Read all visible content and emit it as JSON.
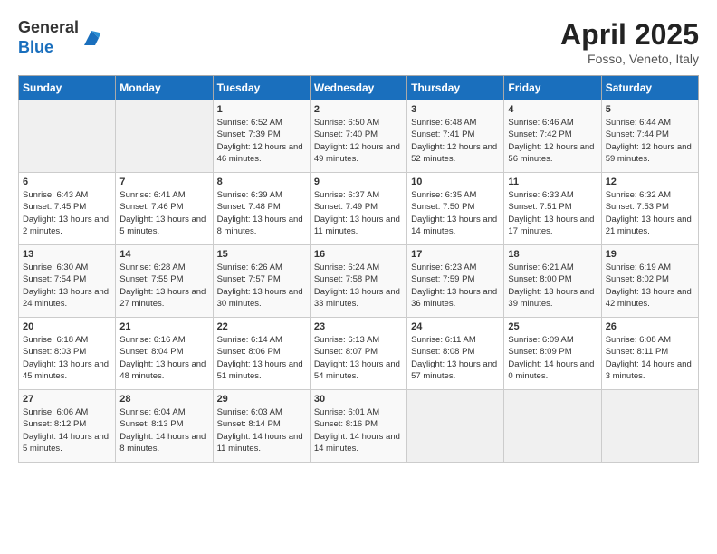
{
  "logo": {
    "general": "General",
    "blue": "Blue"
  },
  "title": "April 2025",
  "subtitle": "Fosso, Veneto, Italy",
  "weekdays": [
    "Sunday",
    "Monday",
    "Tuesday",
    "Wednesday",
    "Thursday",
    "Friday",
    "Saturday"
  ],
  "weeks": [
    [
      {
        "day": "",
        "info": ""
      },
      {
        "day": "",
        "info": ""
      },
      {
        "day": "1",
        "info": "Sunrise: 6:52 AM\nSunset: 7:39 PM\nDaylight: 12 hours and 46 minutes."
      },
      {
        "day": "2",
        "info": "Sunrise: 6:50 AM\nSunset: 7:40 PM\nDaylight: 12 hours and 49 minutes."
      },
      {
        "day": "3",
        "info": "Sunrise: 6:48 AM\nSunset: 7:41 PM\nDaylight: 12 hours and 52 minutes."
      },
      {
        "day": "4",
        "info": "Sunrise: 6:46 AM\nSunset: 7:42 PM\nDaylight: 12 hours and 56 minutes."
      },
      {
        "day": "5",
        "info": "Sunrise: 6:44 AM\nSunset: 7:44 PM\nDaylight: 12 hours and 59 minutes."
      }
    ],
    [
      {
        "day": "6",
        "info": "Sunrise: 6:43 AM\nSunset: 7:45 PM\nDaylight: 13 hours and 2 minutes."
      },
      {
        "day": "7",
        "info": "Sunrise: 6:41 AM\nSunset: 7:46 PM\nDaylight: 13 hours and 5 minutes."
      },
      {
        "day": "8",
        "info": "Sunrise: 6:39 AM\nSunset: 7:48 PM\nDaylight: 13 hours and 8 minutes."
      },
      {
        "day": "9",
        "info": "Sunrise: 6:37 AM\nSunset: 7:49 PM\nDaylight: 13 hours and 11 minutes."
      },
      {
        "day": "10",
        "info": "Sunrise: 6:35 AM\nSunset: 7:50 PM\nDaylight: 13 hours and 14 minutes."
      },
      {
        "day": "11",
        "info": "Sunrise: 6:33 AM\nSunset: 7:51 PM\nDaylight: 13 hours and 17 minutes."
      },
      {
        "day": "12",
        "info": "Sunrise: 6:32 AM\nSunset: 7:53 PM\nDaylight: 13 hours and 21 minutes."
      }
    ],
    [
      {
        "day": "13",
        "info": "Sunrise: 6:30 AM\nSunset: 7:54 PM\nDaylight: 13 hours and 24 minutes."
      },
      {
        "day": "14",
        "info": "Sunrise: 6:28 AM\nSunset: 7:55 PM\nDaylight: 13 hours and 27 minutes."
      },
      {
        "day": "15",
        "info": "Sunrise: 6:26 AM\nSunset: 7:57 PM\nDaylight: 13 hours and 30 minutes."
      },
      {
        "day": "16",
        "info": "Sunrise: 6:24 AM\nSunset: 7:58 PM\nDaylight: 13 hours and 33 minutes."
      },
      {
        "day": "17",
        "info": "Sunrise: 6:23 AM\nSunset: 7:59 PM\nDaylight: 13 hours and 36 minutes."
      },
      {
        "day": "18",
        "info": "Sunrise: 6:21 AM\nSunset: 8:00 PM\nDaylight: 13 hours and 39 minutes."
      },
      {
        "day": "19",
        "info": "Sunrise: 6:19 AM\nSunset: 8:02 PM\nDaylight: 13 hours and 42 minutes."
      }
    ],
    [
      {
        "day": "20",
        "info": "Sunrise: 6:18 AM\nSunset: 8:03 PM\nDaylight: 13 hours and 45 minutes."
      },
      {
        "day": "21",
        "info": "Sunrise: 6:16 AM\nSunset: 8:04 PM\nDaylight: 13 hours and 48 minutes."
      },
      {
        "day": "22",
        "info": "Sunrise: 6:14 AM\nSunset: 8:06 PM\nDaylight: 13 hours and 51 minutes."
      },
      {
        "day": "23",
        "info": "Sunrise: 6:13 AM\nSunset: 8:07 PM\nDaylight: 13 hours and 54 minutes."
      },
      {
        "day": "24",
        "info": "Sunrise: 6:11 AM\nSunset: 8:08 PM\nDaylight: 13 hours and 57 minutes."
      },
      {
        "day": "25",
        "info": "Sunrise: 6:09 AM\nSunset: 8:09 PM\nDaylight: 14 hours and 0 minutes."
      },
      {
        "day": "26",
        "info": "Sunrise: 6:08 AM\nSunset: 8:11 PM\nDaylight: 14 hours and 3 minutes."
      }
    ],
    [
      {
        "day": "27",
        "info": "Sunrise: 6:06 AM\nSunset: 8:12 PM\nDaylight: 14 hours and 5 minutes."
      },
      {
        "day": "28",
        "info": "Sunrise: 6:04 AM\nSunset: 8:13 PM\nDaylight: 14 hours and 8 minutes."
      },
      {
        "day": "29",
        "info": "Sunrise: 6:03 AM\nSunset: 8:14 PM\nDaylight: 14 hours and 11 minutes."
      },
      {
        "day": "30",
        "info": "Sunrise: 6:01 AM\nSunset: 8:16 PM\nDaylight: 14 hours and 14 minutes."
      },
      {
        "day": "",
        "info": ""
      },
      {
        "day": "",
        "info": ""
      },
      {
        "day": "",
        "info": ""
      }
    ]
  ]
}
